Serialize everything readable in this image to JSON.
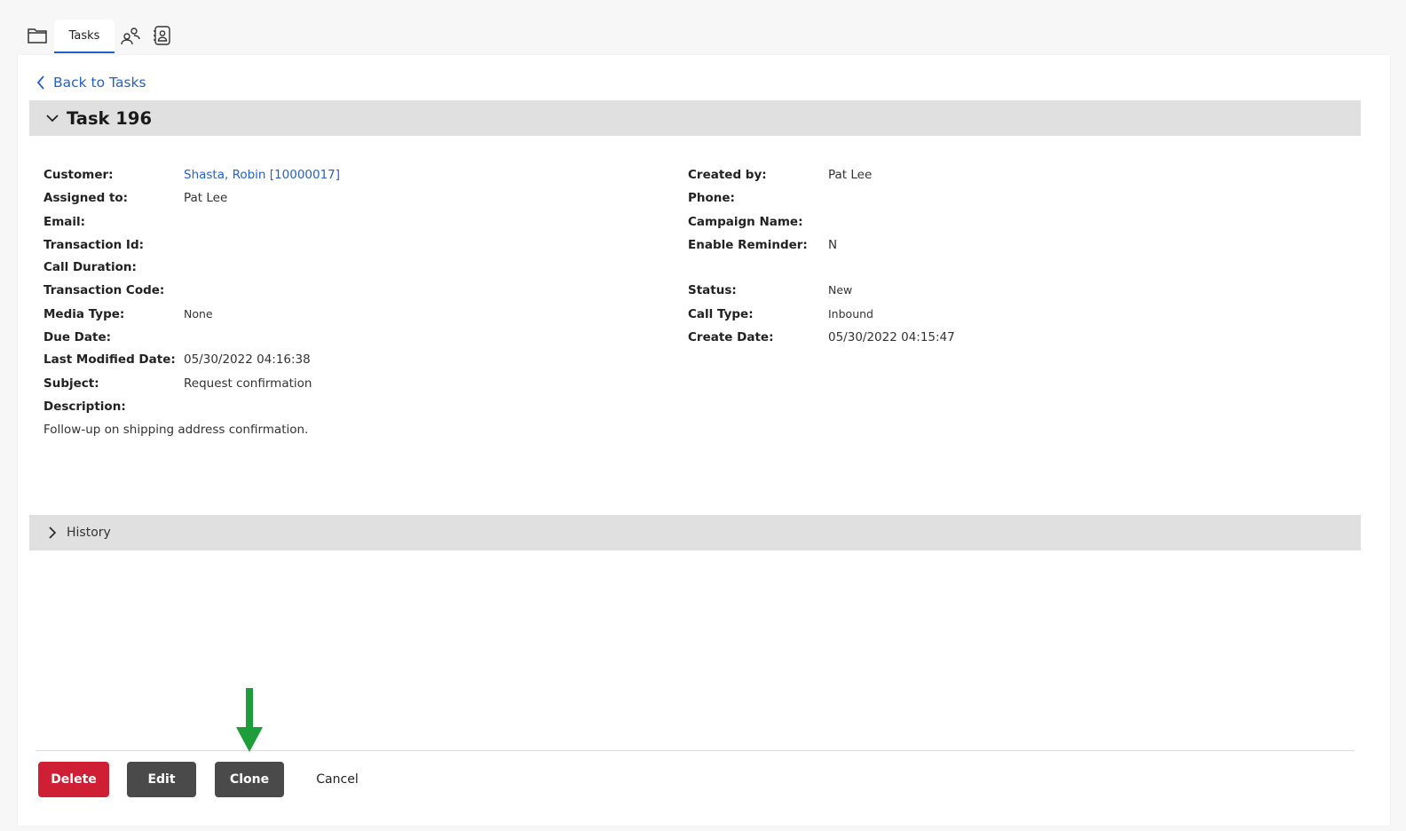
{
  "tabs": {
    "folder_icon": "folder-icon",
    "active_tab_label": "Tasks",
    "users_icon": "users-icon",
    "contact_icon": "contact-card-icon"
  },
  "back_link": {
    "label": "Back to Tasks"
  },
  "task": {
    "title": "Task 196"
  },
  "fields_left": [
    {
      "label": "Customer:",
      "value": "Shasta, Robin [10000017]"
    },
    {
      "label": "Assigned to:",
      "value": "Pat Lee"
    },
    {
      "label": "Email:",
      "value": ""
    },
    {
      "label": "Transaction Id:",
      "value": ""
    },
    {
      "label": "Call Duration:",
      "value": ""
    },
    {
      "label": "Transaction Code:",
      "value": ""
    },
    {
      "label": "Media Type:",
      "value": "None"
    },
    {
      "label": "Due Date:",
      "value": ""
    },
    {
      "label": "Last Modified Date:",
      "value": "05/30/2022 04:16:38"
    },
    {
      "label": "Subject:",
      "value": "Request confirmation"
    },
    {
      "label": "Description:",
      "value": ""
    }
  ],
  "description_text": "Follow-up on shipping address confirmation.",
  "fields_right": [
    {
      "label": "Created by:",
      "value": "Pat Lee"
    },
    {
      "label": "Phone:",
      "value": ""
    },
    {
      "label": "Campaign Name:",
      "value": ""
    },
    {
      "label": "Enable Reminder:",
      "value": "N"
    },
    {
      "label": "Status:",
      "value": "New"
    },
    {
      "label": "Call Type:",
      "value": "Inbound"
    },
    {
      "label": "Create Date:",
      "value": "05/30/2022 04:15:47"
    }
  ],
  "history": {
    "title": "History"
  },
  "actions": {
    "delete_label": "Delete",
    "edit_label": "Edit",
    "clone_label": "Clone",
    "cancel_label": "Cancel"
  },
  "colors": {
    "link": "#2660c9",
    "delete": "#cf1f34",
    "dark_button": "#4a4a4a",
    "annotation_arrow": "#1e9e3a"
  }
}
